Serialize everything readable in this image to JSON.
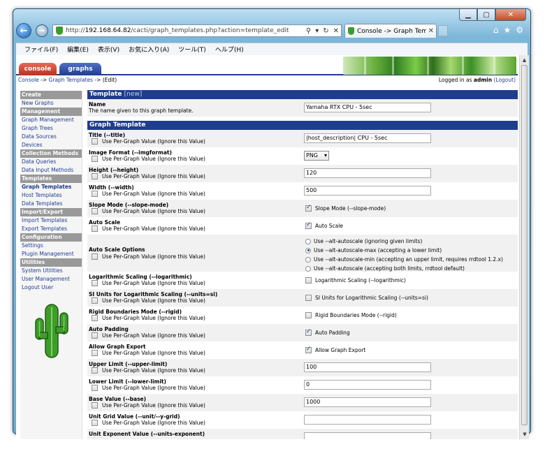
{
  "browser": {
    "url_prefix": "http://",
    "url_host": "192.168.64.82",
    "url_path": "/cacti/graph_templates.php?action=template_edit",
    "tab_title": "Console -> Graph Templ...",
    "menu": [
      "ファイル(F)",
      "編集(E)",
      "表示(V)",
      "お気に入り(A)",
      "ツール(T)",
      "ヘルプ(H)"
    ]
  },
  "cacti": {
    "tabs": {
      "console": "console",
      "graphs": "graphs"
    },
    "breadcrumb": {
      "console": "Console",
      "sep1": " -> ",
      "graph_templates": "Graph Templates",
      "sep2": " -> (Edit)"
    },
    "login": {
      "prefix": "Logged in as ",
      "user": "admin",
      "logout": "(Logout)"
    }
  },
  "sidebar": {
    "sections": [
      {
        "head": "Create",
        "items": [
          "New Graphs"
        ]
      },
      {
        "head": "Management",
        "items": [
          "Graph Management",
          "Graph Trees",
          "Data Sources",
          "Devices"
        ]
      },
      {
        "head": "Collection Methods",
        "items": [
          "Data Queries",
          "Data Input Methods"
        ]
      },
      {
        "head": "Templates",
        "items": [
          "Graph Templates",
          "Host Templates",
          "Data Templates"
        ]
      },
      {
        "head": "Import/Export",
        "items": [
          "Import Templates",
          "Export Templates"
        ]
      },
      {
        "head": "Configuration",
        "items": [
          "Settings",
          "Plugin Management"
        ]
      },
      {
        "head": "Utilities",
        "items": [
          "System Utilities",
          "User Management",
          "Logout User"
        ]
      }
    ]
  },
  "form": {
    "template_section": {
      "title": "Template",
      "new": "[new]"
    },
    "name_label": "Name",
    "name_desc": "The name given to this graph template.",
    "name_value": "Yamaha RTX CPU - 5sec",
    "graph_section": "Graph Template",
    "per_graph": "Use Per-Graph Value (Ignore this Value)",
    "title_label": "Title (--title)",
    "title_value": "|host_description| CPU - 5sec",
    "image_format_label": "Image Format (--imgformat)",
    "image_format_value": "PNG",
    "height_label": "Height (--height)",
    "height_value": "120",
    "width_label": "Width (--width)",
    "width_value": "500",
    "slope_label": "Slope Mode (--slope-mode)",
    "slope_check": "Slope Mode (--slope-mode)",
    "auto_scale_label": "Auto Scale",
    "auto_scale_check": "Auto Scale",
    "auto_scale_options_label": "Auto Scale Options",
    "auto_scale_options": [
      "Use --alt-autoscale (ignoring given limits)",
      "Use --alt-autoscale-max (accepting a lower limit)",
      "Use --alt-autoscale-min (accepting an upper limit, requires rrdtool 1.2.x)",
      "Use --alt-autoscale (accepting both limits, rrdtool default)"
    ],
    "log_label": "Logarithmic Scaling (--logarithmic)",
    "log_check": "Logarithmic Scaling (--logarithmic)",
    "si_label": "SI Units for Logarithmic Scaling (--units=si)",
    "si_check": "SI Units for Logarithmic Scaling (--units=si)",
    "rigid_label": "Rigid Boundaries Mode (--rigid)",
    "rigid_check": "Rigid Boundaries Mode (--rigid)",
    "auto_padding_label": "Auto Padding",
    "auto_padding_check": "Auto Padding",
    "export_label": "Allow Graph Export",
    "export_check": "Allow Graph Export",
    "upper_label": "Upper Limit (--upper-limit)",
    "upper_value": "100",
    "lower_label": "Lower Limit (--lower-limit)",
    "lower_value": "0",
    "base_label": "Base Value (--base)",
    "base_value": "1000",
    "unit_grid_label": "Unit Grid Value (--unit/--y-grid)",
    "unit_grid_value": "",
    "unit_exp_label": "Unit Exponent Value (--units-exponent)"
  }
}
